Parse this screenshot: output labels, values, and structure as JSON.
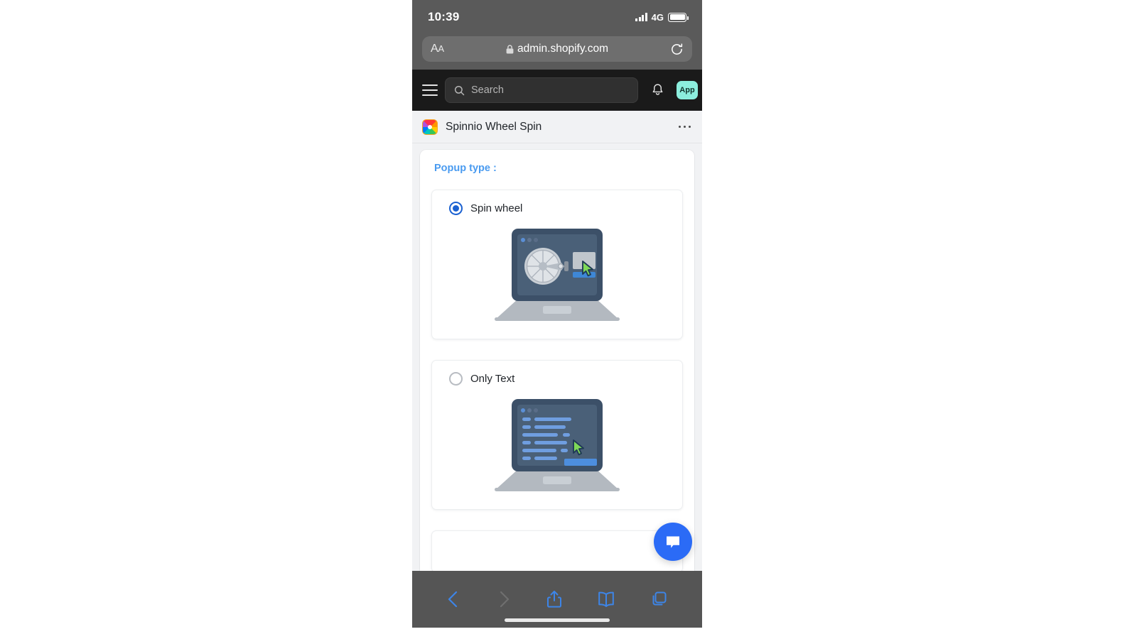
{
  "status_bar": {
    "time": "10:39",
    "network": "4G",
    "signal_icon": "signal-bars-icon",
    "battery_icon": "battery-full-icon"
  },
  "browser": {
    "text_size_button": "AA",
    "lock_icon": "lock-icon",
    "url": "admin.shopify.com",
    "reload_icon": "reload-icon",
    "toolbar": {
      "back_icon": "chevron-left-icon",
      "forward_icon": "chevron-right-icon",
      "share_icon": "share-icon",
      "bookmarks_icon": "book-icon",
      "tabs_icon": "tabs-icon"
    }
  },
  "shopify_nav": {
    "menu_icon": "hamburger-menu-icon",
    "search_icon": "search-icon",
    "search_placeholder": "Search",
    "notifications_icon": "bell-icon",
    "account_badge": "App"
  },
  "app_header": {
    "app_icon": "spinnio-app-icon",
    "title": "Spinnio Wheel Spin",
    "more_icon": "more-horizontal-icon"
  },
  "content": {
    "section_label": "Popup type :",
    "options": [
      {
        "label": "Spin wheel",
        "selected": true,
        "illustration": "laptop-spin-wheel-illustration"
      },
      {
        "label": "Only Text",
        "selected": false,
        "illustration": "laptop-only-text-illustration"
      }
    ]
  },
  "chat_widget": {
    "icon": "chat-bubble-icon"
  },
  "colors": {
    "accent_blue": "#4a9bf0",
    "radio_selected": "#1b61d1",
    "chat_button": "#2b6bf6",
    "shopify_nav_bg": "#1a1a1a",
    "app_badge_bg": "#8ceedd",
    "page_bg": "#f1f2f4",
    "safari_chrome": "#5a5a5a"
  }
}
